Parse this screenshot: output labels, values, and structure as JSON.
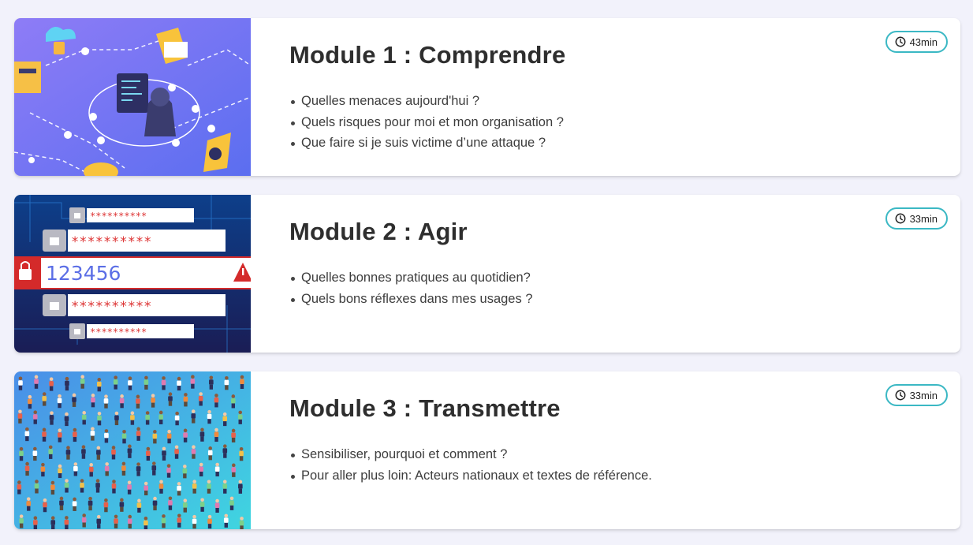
{
  "modules": [
    {
      "title": "Module 1 : Comprendre",
      "duration": "43min",
      "topics": [
        "Quelles menaces aujourd'hui ?",
        "Quels risques pour moi et mon organisation ?",
        "Que faire si je suis victime d’une attaque ?"
      ],
      "image": "cybersecurity-network-illustration"
    },
    {
      "title": "Module 2 : Agir",
      "duration": "33min",
      "topics": [
        "Quelles bonnes pratiques au quotidien?",
        "Quels bons réflexes dans mes usages ?"
      ],
      "image": "password-fields-illustration",
      "image_text": {
        "masked": "**********",
        "weak_password": "123456"
      }
    },
    {
      "title": "Module 3 : Transmettre",
      "duration": "33min",
      "topics": [
        "Sensibiliser, pourquoi et comment ?",
        "Pour aller plus loin: Acteurs nationaux et textes de référence."
      ],
      "image": "crowd-of-people-illustration"
    }
  ],
  "colors": {
    "accent": "#3bb8c4",
    "page_background": "#f2f2fb",
    "title": "#2e2e2e"
  },
  "icons": {
    "duration": "clock-icon"
  }
}
